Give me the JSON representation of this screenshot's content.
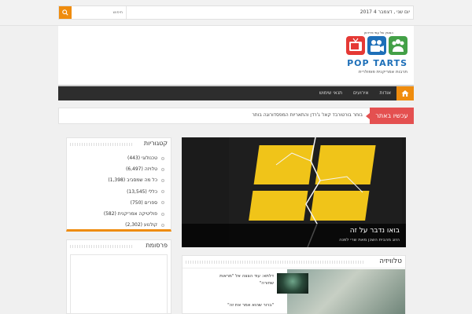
{
  "topbar": {
    "search_placeholder": "חיפוש",
    "date": "יום שני , דצמבר 4 2017"
  },
  "logo": {
    "tagline_top": "המגזין של עמי פרידמן",
    "title": "POP TARTS",
    "tagline": "תרבות אמריקנית פופולרית",
    "colors": {
      "tv": "#e53935",
      "camera": "#1d6fb8",
      "people": "#43a047"
    }
  },
  "nav": {
    "home_icon": "home-icon",
    "items": [
      {
        "label": "אודות"
      },
      {
        "label": "אירועים"
      },
      {
        "label": "תנאי שימוש"
      }
    ]
  },
  "breaking": {
    "label": "עכשיו באתר",
    "text": "בוחר בורטורבד קאז' ג'רדן והתאריות המפסדורוגה בותר"
  },
  "slider": {
    "title": "בואו נדבר על זה",
    "subtitle": "הזוג מהבית השכן מאת שרי לפנה"
  },
  "tv_section": {
    "title": "טלוויזיה",
    "item1": "דלתא: עוד הצצה אל \"מראות שחורה\"",
    "item2": "\"ברור שהוא אמר את זה\""
  },
  "categories": {
    "title": "קטגוריות",
    "items": [
      {
        "label": "טכנולוגי (443)"
      },
      {
        "label": "טלויזה (6,497)"
      },
      {
        "label": "כל מה שמסביב (1,398)"
      },
      {
        "label": "כללי (13,545)"
      },
      {
        "label": "ספרים (750)"
      },
      {
        "label": "פוליטיקה אמריקנית (582)"
      },
      {
        "label": "קולנוע (2,302)"
      }
    ]
  },
  "ads": {
    "title": "פרסומת"
  },
  "colors": {
    "accent": "#ef8c0e",
    "breaking": "#e45050",
    "nav": "#2d2d2d"
  }
}
